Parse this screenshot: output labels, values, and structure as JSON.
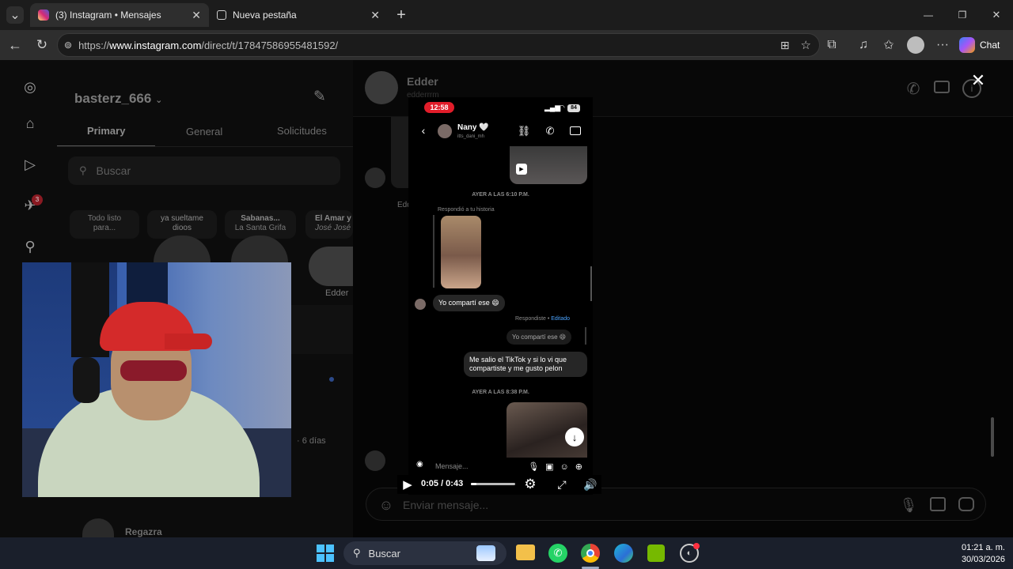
{
  "browser": {
    "tabs": [
      {
        "label": "(3) Instagram • Mensajes",
        "active": true
      },
      {
        "label": "Nueva pestaña",
        "active": false
      }
    ],
    "url_prefix": "https://",
    "url_domain": "www.instagram.com",
    "url_path": "/direct/t/17847586955481592/",
    "chat_label": "Chat"
  },
  "sidebar": {
    "notification_count": "3"
  },
  "inbox": {
    "username": "basterz_666",
    "tabs": [
      "Primary",
      "General",
      "Solicitudes"
    ],
    "search_placeholder": "Buscar",
    "notes": [
      {
        "line1": "Todo listo",
        "line2": "para..."
      },
      {
        "line1": "ya sueltame",
        "line2": "dioos"
      },
      {
        "line1": "Sabanas...",
        "line2": "La Santa Grifa"
      },
      {
        "line1": "El Amar y",
        "line2": "José José"
      }
    ],
    "story_name": "Edder",
    "time_ago": "· 6 días",
    "last_name": "Regazra"
  },
  "conversation": {
    "name": "Edder",
    "handle": "edderrrm",
    "partial_label": "Edd",
    "message_placeholder": "Enviar mensaje..."
  },
  "video": {
    "phone_time": "12:58",
    "battery": "84",
    "contact_name": "Nany 🤍",
    "contact_handle": "itts_dani_mh",
    "timestamp1": "AYER A LAS 6:10 P.M.",
    "replied_label": "Respondió a tu historia",
    "msg1": "Yo compartí ese 😄",
    "reply_label": "Respondiste",
    "edited_label": "Editado",
    "msg2": "Yo compartí ese 😄",
    "msg3_line1": "Me salio  el TikTok y si lo vi que",
    "msg3_line2": "compartiste y me gusto pelon",
    "timestamp2": "AYER A LAS 8:38 P.M.",
    "input_placeholder": "Mensaje...",
    "time_display": "0:05 / 0:43",
    "progress": 0.12
  },
  "taskbar": {
    "search_label": "Buscar",
    "time": "01:21 a. m.",
    "date": "30/03/2026"
  },
  "colors": {
    "accent_red": "#ff3040",
    "link_blue": "#4aa3ff",
    "ig_gradient": "#d62976"
  }
}
